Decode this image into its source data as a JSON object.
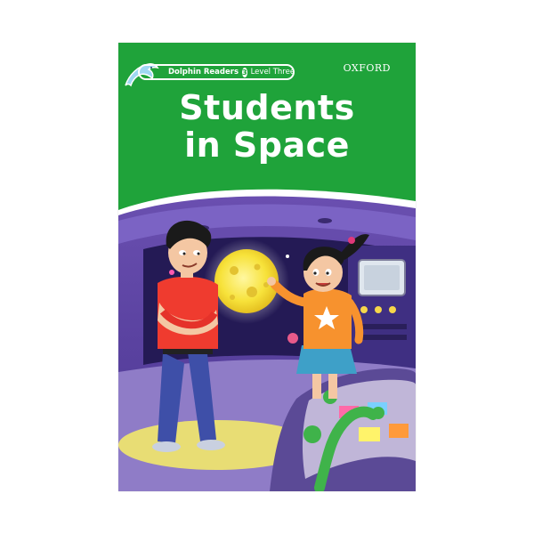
{
  "series": {
    "name": "Dolphin Readers",
    "level_number": "3",
    "level_text": "Level Three"
  },
  "publisher": "OXFORD",
  "title": {
    "line1": "Students",
    "line2": "in Space"
  },
  "colors": {
    "cover_green": "#1fa33a",
    "background": "#ffffff"
  }
}
